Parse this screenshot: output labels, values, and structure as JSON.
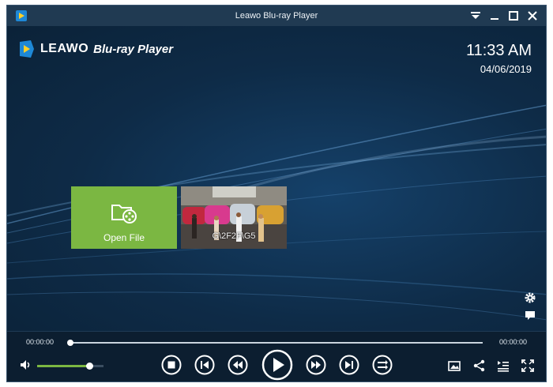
{
  "window": {
    "title": "Leawo Blu-ray Player"
  },
  "header": {
    "brand": "LEAWO",
    "product": "Blu-ray Player",
    "time": "11:33 AM",
    "date": "04/06/2019"
  },
  "tiles": {
    "open_file_label": "Open File",
    "media_label": "G\\2F2F\\G5"
  },
  "playback": {
    "current_time": "00:00:00",
    "total_time": "00:00:00",
    "progress_fraction": 0.0,
    "volume_fraction": 0.78
  },
  "colors": {
    "accent_green": "#7bb742",
    "background": "#0f2a44",
    "titlebar": "#203a52"
  },
  "icons": {
    "titlebar": [
      "app-icon",
      "dropdown-icon",
      "minimize-icon",
      "maximize-icon",
      "close-icon"
    ],
    "side": [
      "settings-gear-icon",
      "chat-bubble-icon"
    ],
    "transport": [
      "stop-icon",
      "previous-chapter-icon",
      "rewind-icon",
      "play-icon",
      "fast-forward-icon",
      "next-chapter-icon",
      "playlist-icon"
    ],
    "right": [
      "snapshot-icon",
      "share-icon",
      "chapter-list-icon",
      "fullscreen-icon"
    ]
  }
}
